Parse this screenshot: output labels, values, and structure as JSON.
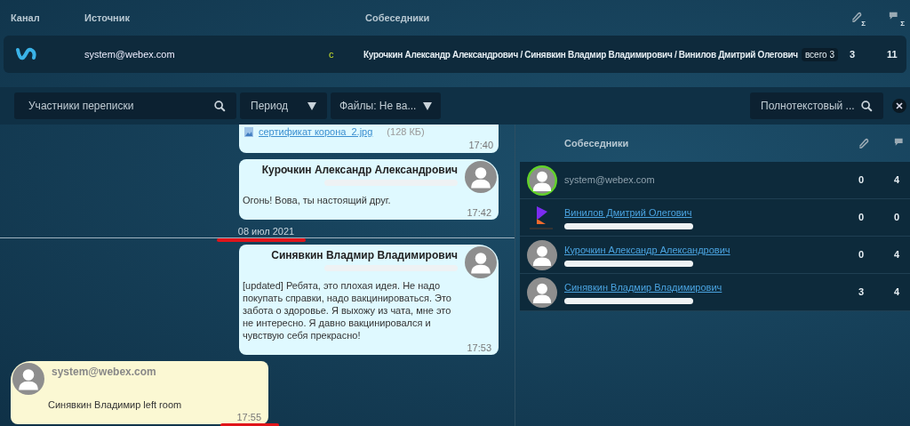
{
  "header": {
    "columns": [
      "Канал",
      "Источник",
      "Собеседники"
    ],
    "attachment_total_mark": "Σ",
    "message_total_mark": "Σ"
  },
  "channel_row": {
    "source": "system@webex.com",
    "marker": "с",
    "participants": "Курочкин Александр Александрович / Синявкин Владмир Владимирович / Винилов Дмитрий Олегович",
    "total_badge": "всего 3",
    "attachments": "3",
    "messages": "11"
  },
  "filters": {
    "participants": {
      "placeholder": "Участники переписки"
    },
    "period": "Период",
    "files": "Файлы: Не ва...",
    "fulltext": {
      "placeholder": "Полнотекстовый ..."
    }
  },
  "chat": [
    {
      "kind": "file",
      "file_name": "сертификат корона_2.jpg",
      "file_size": "(128 КБ)",
      "time": "17:40"
    },
    {
      "kind": "message",
      "author": "Курочкин Александр Александрович",
      "email_redacted": true,
      "text": "Огонь! Вова, ты настоящий друг.",
      "time": "17:42",
      "time_marked": false
    },
    {
      "kind": "date",
      "label": "08 июл 2021",
      "marked": true
    },
    {
      "kind": "message",
      "author": "Синявкин Владмир Владимирович",
      "email_redacted": true,
      "text": "[updated] Ребята, это плохая идея. Не надо покупать справки, надо вакцинироваться. Это забота о здоровье. Я выхожу из чата, мне это не интересно. Я давно вакцинировался и чувствую себя прекрасно!",
      "time": "17:53",
      "time_marked": false
    },
    {
      "kind": "system",
      "author": "system@webex.com",
      "email_redacted": false,
      "text": "Синявкин Владимир left room",
      "time": "17:55",
      "time_marked": true
    }
  ],
  "participants_panel": {
    "title": "Собеседники",
    "rows": [
      {
        "name": "system@webex.com",
        "kind": "person",
        "online": true,
        "linked": false,
        "email_redacted": false,
        "attachments": "0",
        "messages": "4"
      },
      {
        "name": "Винилов Дмитрий Олегович",
        "kind": "logo",
        "online": false,
        "linked": true,
        "email_redacted": true,
        "attachments": "0",
        "messages": "0"
      },
      {
        "name": "Курочкин Александр Александрович",
        "kind": "person",
        "online": false,
        "linked": true,
        "email_redacted": true,
        "attachments": "0",
        "messages": "4"
      },
      {
        "name": "Синявкин Владмир Владимирович",
        "kind": "person",
        "online": false,
        "linked": true,
        "email_redacted": true,
        "attachments": "3",
        "messages": "4"
      }
    ]
  }
}
